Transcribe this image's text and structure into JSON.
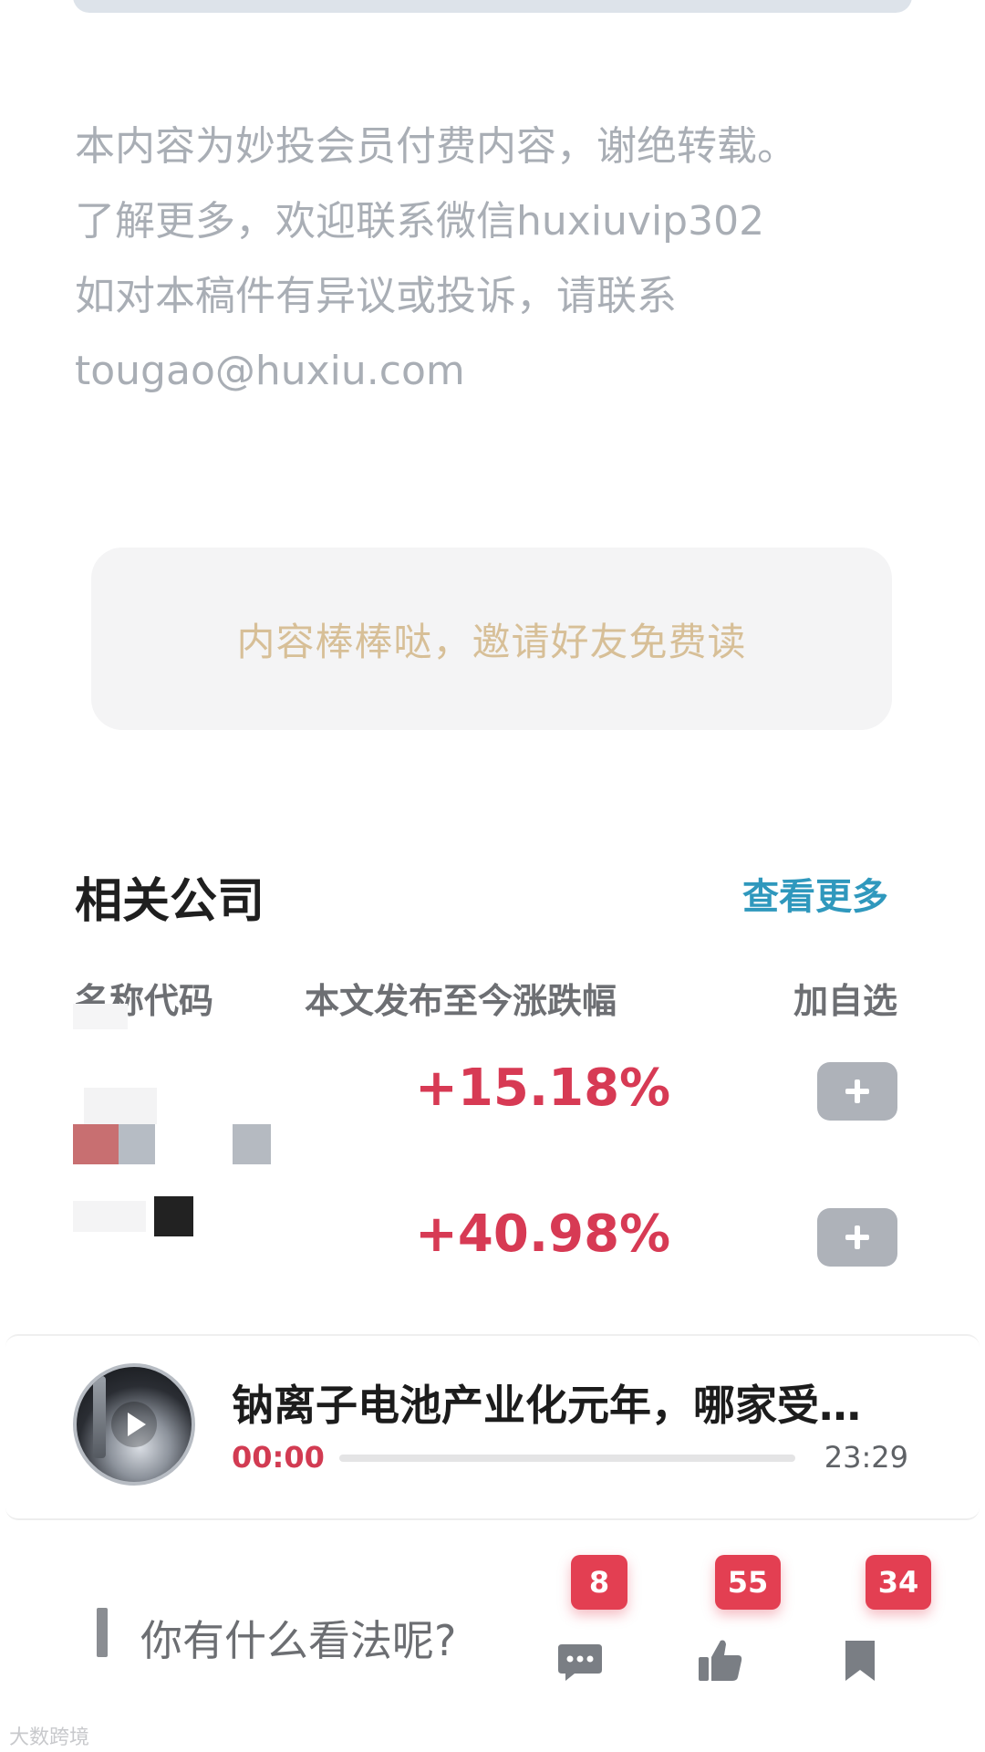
{
  "notice": {
    "line1": "本内容为妙投会员付费内容，谢绝转载。",
    "line2": "了解更多，欢迎联系微信huxiuvip302",
    "line3": "如对本稿件有异议或投诉，请联系",
    "line4": "tougao@huxiu.com"
  },
  "invite": {
    "label": "内容棒棒哒，邀请好友免费读"
  },
  "related": {
    "title": "相关公司",
    "more_label": "查看更多",
    "columns": {
      "name": "名称代码",
      "change": "本文发布至今涨跌幅",
      "add": "加自选"
    },
    "rows": [
      {
        "change": "+15.18%"
      },
      {
        "change": "+40.98%"
      }
    ]
  },
  "player": {
    "title": "钠离子电池产业化元年，哪家受…",
    "current_time": "00:00",
    "total_time": "23:29",
    "progress": 0
  },
  "comment": {
    "prompt": "你有什么看法呢?",
    "comment_count": "8",
    "like_count": "55",
    "favorite_count": "34"
  },
  "watermark": "大数跨境",
  "colors": {
    "accent_red": "#d73a54",
    "link_blue": "#2f98bd",
    "invite_text": "#d7bf97"
  }
}
